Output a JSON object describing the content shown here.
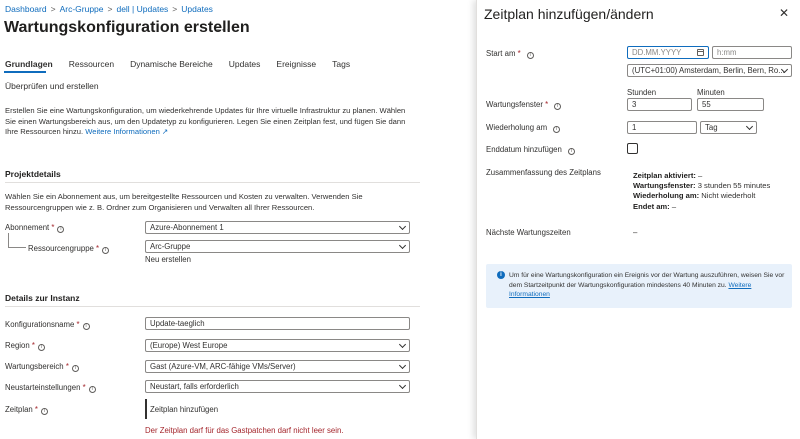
{
  "breadcrumb": [
    "Dashboard",
    "Arc-Gruppe",
    "dell | Updates",
    "Updates"
  ],
  "page_title": "Wartungskonfiguration erstellen",
  "tabs": [
    "Grundlagen",
    "Ressourcen",
    "Dynamische Bereiche",
    "Updates",
    "Ereignisse",
    "Tags"
  ],
  "tab_second_row": "Überprüfen und erstellen",
  "intro": {
    "text": "Erstellen Sie eine Wartungskonfiguration, um wiederkehrende Updates für Ihre virtuelle Infrastruktur zu planen. Wählen Sie einen Wartungsbereich aus, um den Updatetyp zu konfigurieren. Legen Sie einen Zeitplan fest, und fügen Sie dann Ihre Ressourcen hinzu.",
    "link": "Weitere Informationen"
  },
  "project": {
    "heading": "Projektdetails",
    "text": "Wählen Sie ein Abonnement aus, um bereitgestellte Ressourcen und Kosten zu verwalten. Verwenden Sie Ressourcengruppen wie z. B. Ordner zum Organisieren und Verwalten all Ihrer Ressourcen.",
    "subscription_label": "Abonnement",
    "subscription_value": "Azure-Abonnement 1",
    "rg_label": "Ressourcengruppe",
    "rg_value": "Arc-Gruppe",
    "create_new": "Neu erstellen"
  },
  "instance": {
    "heading": "Details zur Instanz",
    "name_label": "Konfigurationsname",
    "name_value": "Update-taeglich",
    "region_label": "Region",
    "region_value": "(Europe) West Europe",
    "scope_label": "Wartungsbereich",
    "scope_value": "Gast (Azure-VM, ARC-fähige VMs/Server)",
    "reboot_label": "Neustarteinstellungen",
    "reboot_value": "Neustart, falls erforderlich",
    "schedule_label": "Zeitplan",
    "schedule_link": "Zeitplan hinzufügen",
    "schedule_error": "Der Zeitplan darf für das Gastpatchen darf nicht leer sein."
  },
  "panel": {
    "title": "Zeitplan hinzufügen/ändern",
    "start_label": "Start am",
    "date_placeholder": "DD.MM.YYYY",
    "time_placeholder": "h:mm",
    "timezone": "(UTC+01:00) Amsterdam, Berlin, Bern, Ro...",
    "hours_header": "Stunden",
    "minutes_header": "Minuten",
    "window_label": "Wartungsfenster",
    "window_hours": "3",
    "window_minutes": "55",
    "repeat_label": "Wiederholung am",
    "repeat_value": "1",
    "repeat_unit": "Tag",
    "enddate_label": "Enddatum hinzufügen",
    "summary_label": "Zusammenfassung des Zeitplans",
    "summary": [
      {
        "k": "Zeitplan aktiviert:",
        "v": " –"
      },
      {
        "k": "Wartungsfenster:",
        "v": " 3 stunden 55 minutes"
      },
      {
        "k": "Wiederholung am:",
        "v": " Nicht wiederholt"
      },
      {
        "k": "Endet am:",
        "v": " –"
      }
    ],
    "next_label": "Nächste Wartungszeiten",
    "next_value": "–",
    "info_text": "Um für eine Wartungskonfiguration ein Ereignis vor der Wartung auszuführen, weisen Sie vor dem Startzeitpunkt der Wartungskonfiguration mindestens 40 Minuten zu.",
    "info_link": "Weitere Informationen"
  },
  "colors": {
    "accent": "#0f6cbd",
    "error": "#a4262c",
    "info_bg": "#e8f1fb"
  }
}
